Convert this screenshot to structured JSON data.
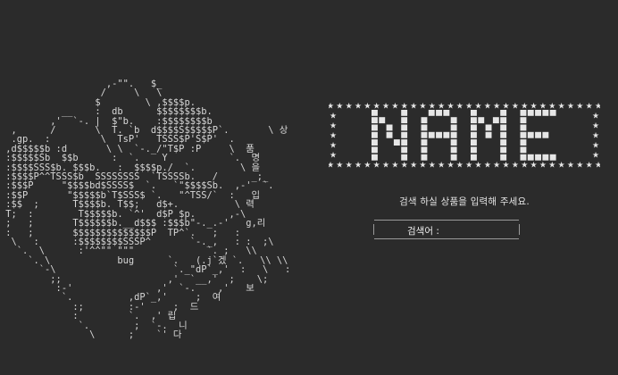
{
  "ascii_art": "                   ,-\"\".   $_\n                  /     \\   \\\n                 $        \\ ,$$$$p.\n           __    :  db      $$$$$$$$b.\n         ,'  `-. |  $\"b.    :$$$$$$$$b\n  ,      /       \\  T. `b  d$$$$S$$$$$P`.       \\ 상\n  .gp.  :         \\  TsP'   TSSS$P'S$P'  .\n ,d$$$$$b :d       \\ \\  `-._/\"T$P :P     \\  품\n :$$$$$Sb  $$b      :  `.    Y           `.  명\n :$$$$SSS$b. $$$b.   :  $$$$p./  `.        \\ 을\n :$$$$P^^TSSS$b  SSSSSSSS  `TSSSSb.   /      _;_\n :$$$P     \"$$$$bd$SSSS$  `.   `\"$$$$Sb.  ,-'  `.\n :$$P       \"$$$$$b`T$SSS$ `.   \"^TSS/`  :   입\n :$$  ;      T$$$$b. T$$;   d$+.          \\ 력\n T;  :        T$$$$$b. `^'  d$P $p.      ,-\\\n ;   ;       T$$$$$$b.__d$$$ :$$$b\"-._.-'   g,리\n :   ;       $$$$$$$$$$$$$$P  TP^`.   ;   :\n  \\   :      :$$$$$$$$SSSP^       `-._,   : :  ;\\\n   `.  \\      :'^^\"\" \"\"\"             `. ;   \\\\\n     `. \\            bug      `.   (.j`겠 `.   \\\\ \\\\\n       `-\\                     `._\"dP`_,'  :   \\   :\n         ;;                   ,'  `__,'  ;    \\;\n          :-'               ,'  `-.    ,'   보\n           `.          ,dP`_,'     ;  여\n             :;        :-'     ;  드\n             :         `.  ,' 립\n              `.        ;  `-.  니\n                \\      ;    `' 다",
  "banner": {
    "title": "NAME",
    "border_glyph": "★"
  },
  "instruction": "검색 하실 상품을 입력해 주세요.",
  "search": {
    "label": "검색어 :",
    "value": "",
    "placeholder": ""
  },
  "colors": {
    "background": "#2b2b2b",
    "text": "#e6e6e6",
    "border": "#9a9a9a"
  }
}
